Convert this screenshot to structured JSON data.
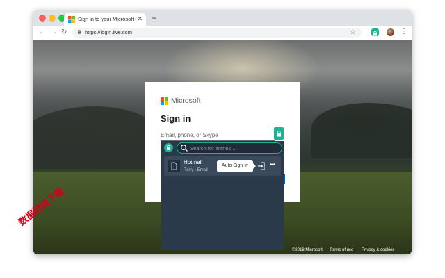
{
  "browser": {
    "tab_title": "Sign in to your Microsoft acco…",
    "url": "https://login.live.com",
    "icons": [
      "back-icon",
      "forward-icon",
      "reload-icon",
      "lock-icon",
      "bookmark-star-icon",
      "extension-icon",
      "profile-avatar",
      "menu-icon"
    ]
  },
  "signin": {
    "brand": "Microsoft",
    "title": "Sign in",
    "email_placeholder": "Email, phone, or Skype",
    "footer": {
      "copyright": "©2018 Microsoft",
      "terms": "Terms of use",
      "privacy": "Privacy & cookies",
      "more": "···"
    }
  },
  "popup": {
    "search_placeholder": "Search for entries...",
    "entry": {
      "title": "Hotmail",
      "subtitle": "Perry › Email"
    },
    "tooltip": "Auto Sign In",
    "more": "•••"
  },
  "watermark": "数据链接下载",
  "colors": {
    "accent": "#1ab394",
    "popup_bg": "#2a3a4a",
    "ms_red": "#f25022",
    "ms_green": "#7fba00",
    "ms_blue": "#00a4ef",
    "ms_yellow": "#ffb900"
  }
}
